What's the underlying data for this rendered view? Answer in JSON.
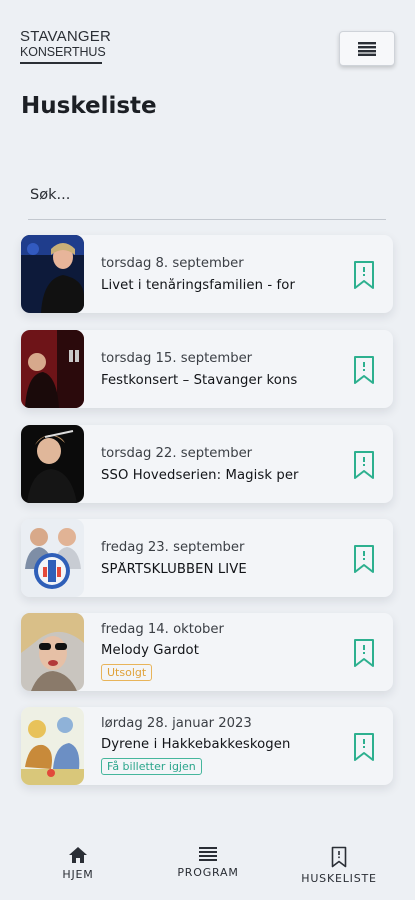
{
  "brand": {
    "line1": "STAVANGER",
    "line2": "KONSERTHUS"
  },
  "page": {
    "title": "Huskeliste"
  },
  "search": {
    "placeholder": "Søk..."
  },
  "items": [
    {
      "date": "torsdag 8. september",
      "title": "Livet i tenåringsfamilien - for",
      "badge": ""
    },
    {
      "date": "torsdag 15. september",
      "title": "Festkonsert – Stavanger kons",
      "badge": ""
    },
    {
      "date": "torsdag 22. september",
      "title": "SSO Hovedserien: Magisk per",
      "badge": ""
    },
    {
      "date": "fredag 23. september",
      "title": "SPÅRTSKLUBBEN LIVE",
      "badge": ""
    },
    {
      "date": "fredag 14. oktober",
      "title": "Melody Gardot",
      "badge": "Utsolgt"
    },
    {
      "date": "lørdag 28. januar 2023",
      "title": "Dyrene i Hakkebakkeskogen",
      "badge": "Få billetter igjen"
    }
  ],
  "nav": {
    "home": "HJEM",
    "program": "PROGRAM",
    "watchlist": "HUSKELISTE"
  },
  "colors": {
    "accent": "#2db08f",
    "soldout": "#e0a23a"
  }
}
